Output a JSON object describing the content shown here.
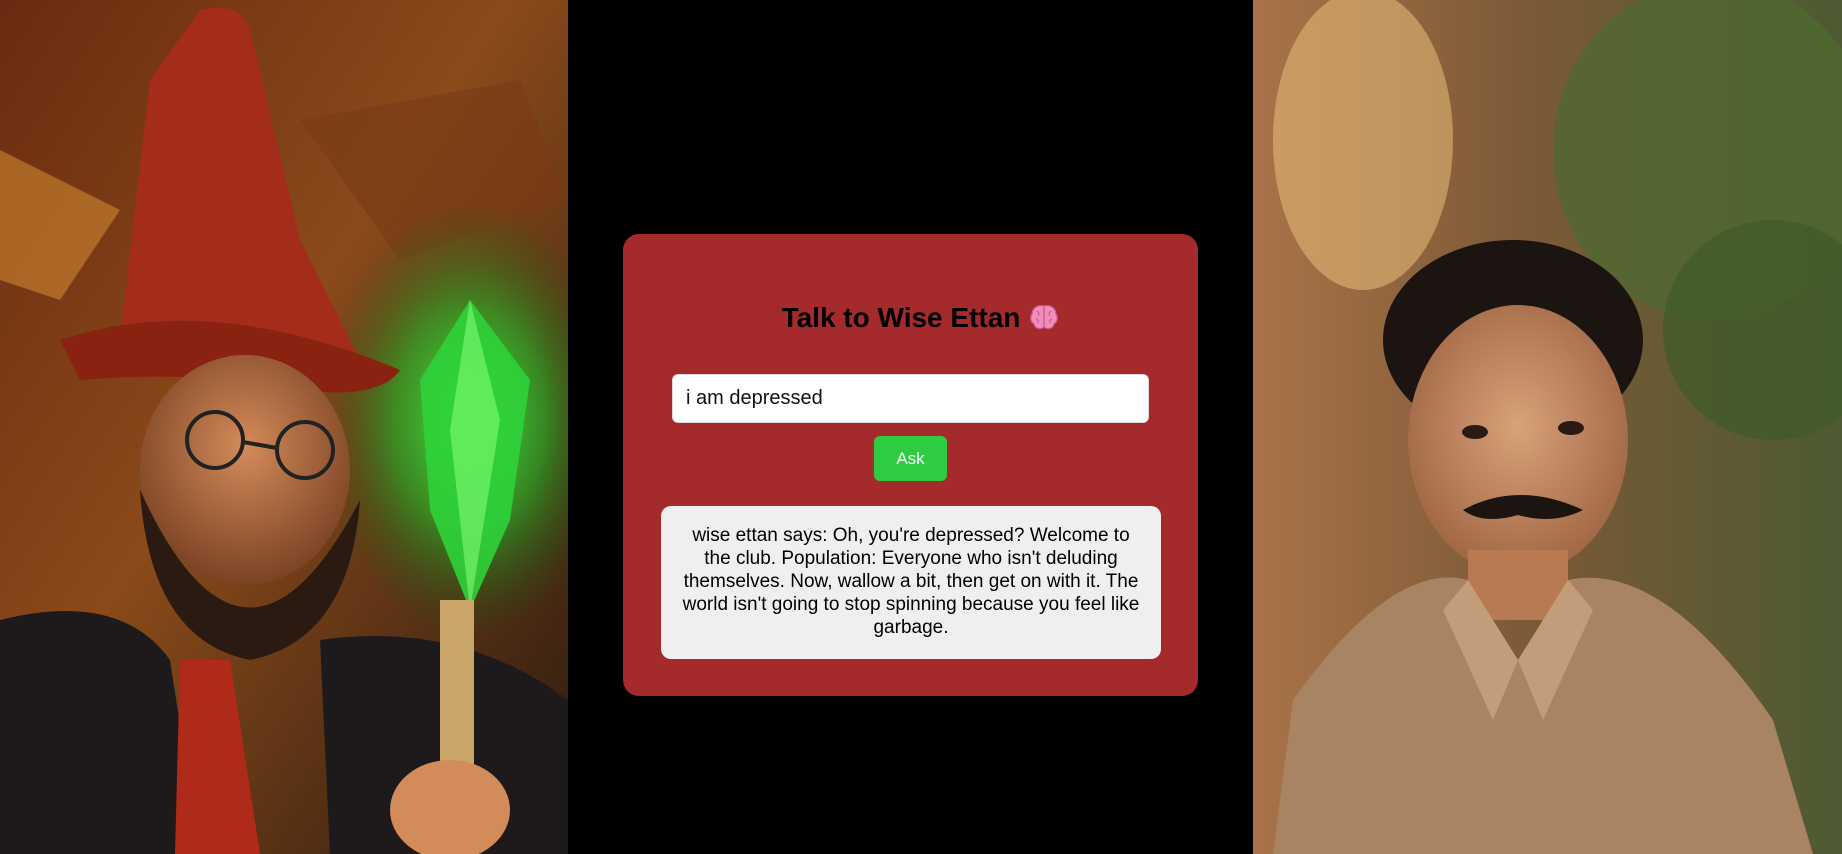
{
  "title": {
    "text": "Talk to Wise Ettan",
    "icon": "brain-icon"
  },
  "input": {
    "value": "i am depressed",
    "placeholder": ""
  },
  "ask_button": {
    "label": "Ask"
  },
  "response": {
    "text": "wise ettan says: Oh, you're depressed? Welcome to the club. Population: Everyone who isn't deluding themselves. Now, wallow a bit, then get on with it. The world isn't going to stop spinning because you feel like garbage."
  },
  "colors": {
    "background": "#000000",
    "card": "#a42a2b",
    "button": "#2ecc40",
    "response_box": "#efefef"
  }
}
